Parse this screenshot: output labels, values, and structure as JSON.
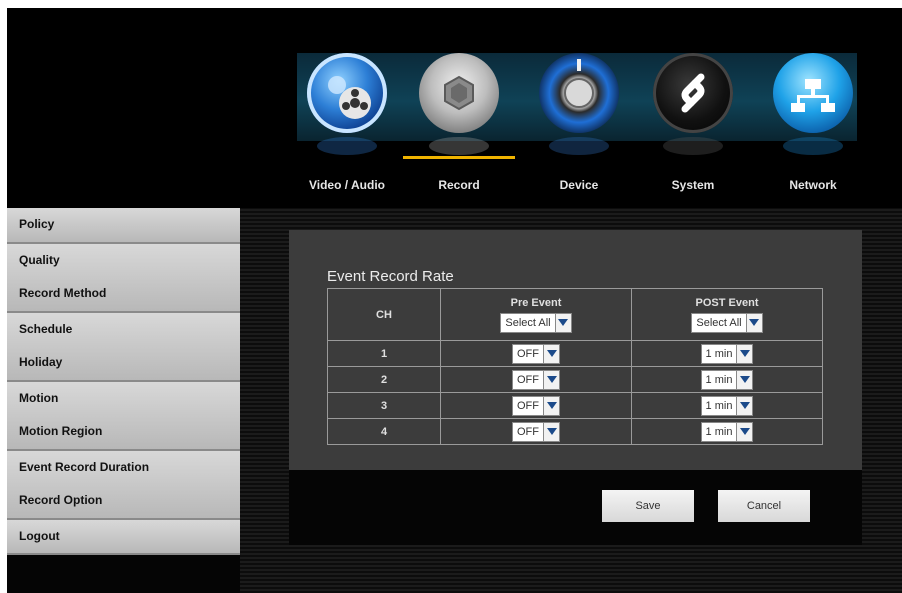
{
  "nav": {
    "tabs": [
      {
        "label": "Video / Audio",
        "icon": "film-reel-icon"
      },
      {
        "label": "Record",
        "icon": "camera-shutter-icon"
      },
      {
        "label": "Device",
        "icon": "power-knob-icon"
      },
      {
        "label": "System",
        "icon": "system-logo-icon"
      },
      {
        "label": "Network",
        "icon": "network-hierarchy-icon"
      }
    ],
    "active": "Record"
  },
  "sidebar": {
    "items": [
      "Policy",
      "Quality",
      "Record Method",
      "Schedule",
      "Holiday",
      "Motion",
      "Motion Region",
      "Event Record Duration",
      "Record Option",
      "Logout"
    ]
  },
  "panel": {
    "title": "Event Record Rate",
    "columns": {
      "ch": "CH",
      "pre": "Pre Event",
      "post": "POST Event"
    },
    "select_all": "Select All",
    "rows": [
      {
        "ch": "1",
        "pre": "OFF",
        "post": "1 min"
      },
      {
        "ch": "2",
        "pre": "OFF",
        "post": "1 min"
      },
      {
        "ch": "3",
        "pre": "OFF",
        "post": "1 min"
      },
      {
        "ch": "4",
        "pre": "OFF",
        "post": "1 min"
      }
    ]
  },
  "buttons": {
    "save": "Save",
    "cancel": "Cancel"
  },
  "colors": {
    "active_underline": "#f0b400",
    "sidebar_bg": "#c8c8c8",
    "panel_bg": "#3c3c3c"
  }
}
